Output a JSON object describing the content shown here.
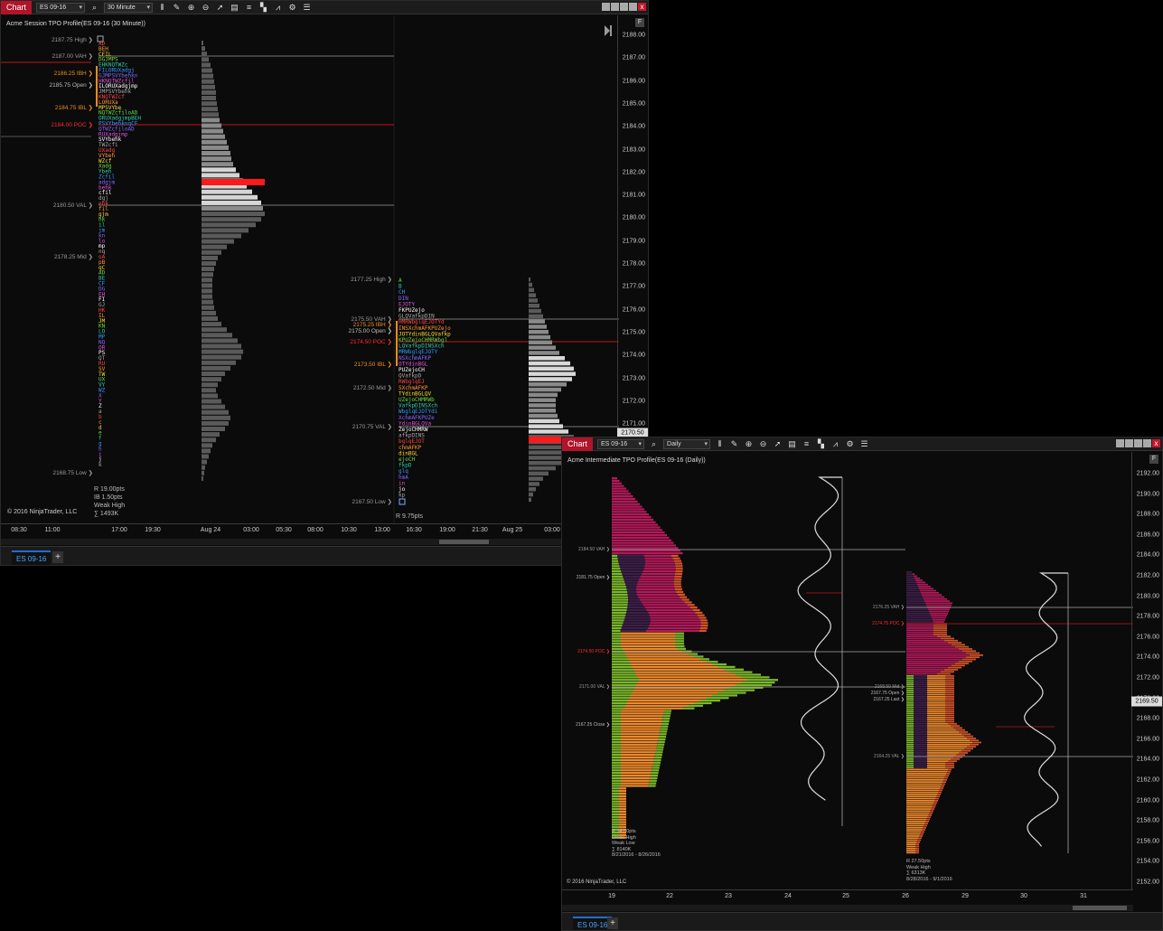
{
  "w1": {
    "chart_tab": "Chart",
    "instrument": "ES 09-16",
    "interval": "30 Minute",
    "title": "Acme Session TPO Profile(ES 09-16 (30 Minute))",
    "copyright": "© 2016 NinjaTrader, LLC",
    "tab": "ES 09-16",
    "tab_add": "+",
    "f_btn": "F",
    "yaxis": [
      "2188.00",
      "2187.00",
      "2186.00",
      "2185.00",
      "2184.00",
      "2183.00",
      "2182.00",
      "2181.00",
      "2180.00",
      "2179.00",
      "2178.00",
      "2177.00",
      "2176.00",
      "2175.00",
      "2174.00",
      "2173.00",
      "2172.00",
      "2171.00"
    ],
    "price_tag": "2170.50",
    "xaxis": [
      "08:30",
      "11:00",
      "17:00",
      "19:30",
      "Aug 24",
      "03:00",
      "05:30",
      "08:00",
      "10:30",
      "13:00",
      "16:30",
      "19:00",
      "21:30",
      "Aug 25",
      "03:00"
    ],
    "levels_a": [
      {
        "text": "2187.75 High",
        "color": "#9a9a9a"
      },
      {
        "text": "2187.00 VAH",
        "color": "#9a9a9a"
      },
      {
        "text": "2186.25 IBH",
        "color": "#f08c1e"
      },
      {
        "text": "2185.75 Open",
        "color": "#bbbbbb"
      },
      {
        "text": "2184.75 IBL",
        "color": "#f08c1e"
      },
      {
        "text": "2184.00 POC",
        "color": "#ff2a2a"
      },
      {
        "text": "2180.50 VAL",
        "color": "#9a9a9a"
      },
      {
        "text": "2178.25 Mid",
        "color": "#9a9a9a"
      },
      {
        "text": "2168.75 Low",
        "color": "#9a9a9a"
      }
    ],
    "levels_b": [
      {
        "text": "2177.25 High",
        "color": "#9a9a9a"
      },
      {
        "text": "2175.50 VAH",
        "color": "#9a9a9a"
      },
      {
        "text": "2175.25 IBH",
        "color": "#f08c1e"
      },
      {
        "text": "2175.00 Open",
        "color": "#bbbbbb"
      },
      {
        "text": "2174.50 POC",
        "color": "#ff2a2a"
      },
      {
        "text": "2173.50 IBL",
        "color": "#f08c1e"
      },
      {
        "text": "2172.50 Mid",
        "color": "#9a9a9a"
      },
      {
        "text": "2170.75 VAL",
        "color": "#9a9a9a"
      },
      {
        "text": "2167.50 Low",
        "color": "#9a9a9a"
      }
    ],
    "stats_a": [
      "R 19.00pts",
      "IB 1.50pts",
      "Weak High",
      "∑ 1493K"
    ],
    "stats_b": "R 9.75pts"
  },
  "w2": {
    "chart_tab": "Chart",
    "instrument": "ES 09-16",
    "interval": "Daily",
    "title": "Acme Intermediate TPO Profile(ES 09-16 (Daily))",
    "copyright": "© 2016 NinjaTrader, LLC",
    "tab": "ES 09-16",
    "tab_add": "+",
    "f_btn": "F",
    "yaxis": [
      "2192.00",
      "2190.00",
      "2188.00",
      "2186.00",
      "2184.00",
      "2182.00",
      "2180.00",
      "2178.00",
      "2176.00",
      "2174.00",
      "2172.00",
      "2170.00",
      "2168.00",
      "2166.00",
      "2164.00",
      "2162.00",
      "2160.00",
      "2158.00",
      "2156.00",
      "2154.00",
      "2152.00"
    ],
    "price_tag": "2169.50",
    "xaxis": [
      "19",
      "22",
      "23",
      "24",
      "25",
      "26",
      "29",
      "30",
      "31"
    ],
    "levels_a": [
      {
        "text": "2184.50 VAH",
        "color": "#9a9a9a"
      },
      {
        "text": "2181.75 Open",
        "color": "#bbbbbb"
      },
      {
        "text": "2174.50 POC",
        "color": "#ff2a2a"
      },
      {
        "text": "2171.00 VAL",
        "color": "#9a9a9a"
      },
      {
        "text": "2167.25 Close",
        "color": "#bbbbbb"
      }
    ],
    "levels_b": [
      {
        "text": "2176.25 VAH",
        "color": "#9a9a9a"
      },
      {
        "text": "2174.75 POC",
        "color": "#ff2a2a"
      },
      {
        "text": "2168.50 Mid",
        "color": "#9a9a9a"
      },
      {
        "text": "2167.75 Open",
        "color": "#bbbbbb"
      },
      {
        "text": "2167.25 Last",
        "color": "#bbbbbb"
      },
      {
        "text": "2164.25 VAL",
        "color": "#9a9a9a"
      }
    ],
    "stats_a": [
      "R 34.00pts",
      "Weak High",
      "Weak Low",
      "∑ 8140K",
      "8/21/2016 - 8/26/2016"
    ],
    "stats_b": [
      "R 27.50pts",
      "Weak High",
      "∑ 6313K",
      "8/28/2016 - 9/1/2016"
    ]
  },
  "colors": {
    "accent": "#b0142a",
    "poc": "#ff2a2a",
    "ib": "#f08c1e",
    "tab_blue": "#4aa3ff"
  }
}
